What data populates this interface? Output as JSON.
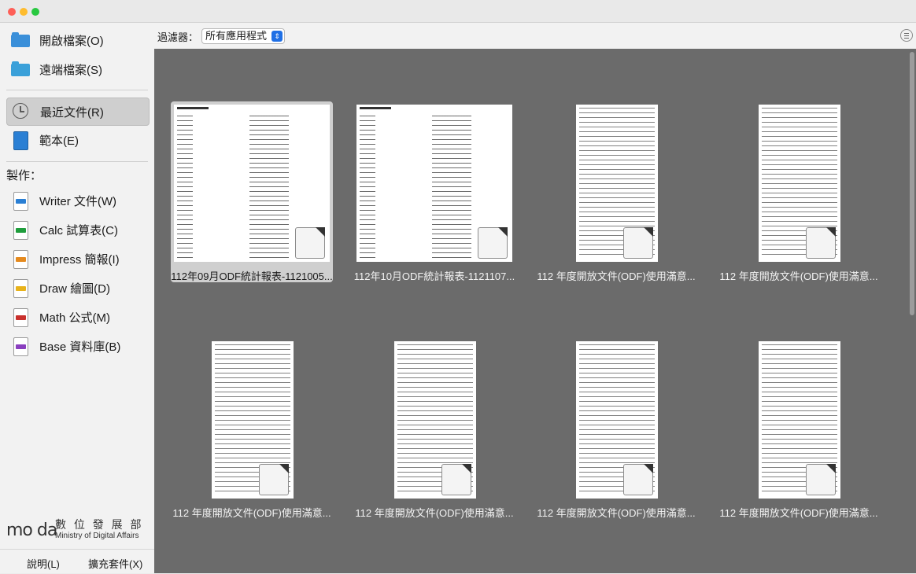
{
  "sidebar": {
    "open_file": "開啟檔案(O)",
    "remote_files": "遠端檔案(S)",
    "recent_docs": "最近文件(R)",
    "templates": "範本(E)",
    "create_label": "製作：",
    "create_items": [
      {
        "label": "Writer 文件(W)",
        "color": "#2a7fd4"
      },
      {
        "label": "Calc 試算表(C)",
        "color": "#1f9d3c"
      },
      {
        "label": "Impress 簡報(I)",
        "color": "#e58a1e"
      },
      {
        "label": "Draw 繪圖(D)",
        "color": "#e8b21a"
      },
      {
        "label": "Math 公式(M)",
        "color": "#c9302c"
      },
      {
        "label": "Base 資料庫(B)",
        "color": "#8a3fbf"
      }
    ],
    "logo_text": "mo da",
    "org_zh": "數 位 發 展 部",
    "org_en": "Ministry of Digital Affairs",
    "help": "說明(L)",
    "extensions": "擴充套件(X)"
  },
  "filter": {
    "label": "過濾器：",
    "selected": "所有應用程式"
  },
  "recent_files": [
    {
      "name": "112年09月ODF統計報表-1121005...",
      "selected": true,
      "kind": "table"
    },
    {
      "name": "112年10月ODF統計報表-1121107...",
      "selected": false,
      "kind": "table"
    },
    {
      "name": "112 年度開放文件(ODF)使用滿意...",
      "selected": false,
      "kind": "list"
    },
    {
      "name": "112 年度開放文件(ODF)使用滿意...",
      "selected": false,
      "kind": "list"
    },
    {
      "name": "112 年度開放文件(ODF)使用滿意...",
      "selected": false,
      "kind": "list"
    },
    {
      "name": "112 年度開放文件(ODF)使用滿意...",
      "selected": false,
      "kind": "list"
    },
    {
      "name": "112 年度開放文件(ODF)使用滿意...",
      "selected": false,
      "kind": "list"
    },
    {
      "name": "112 年度開放文件(ODF)使用滿意...",
      "selected": false,
      "kind": "list"
    }
  ]
}
